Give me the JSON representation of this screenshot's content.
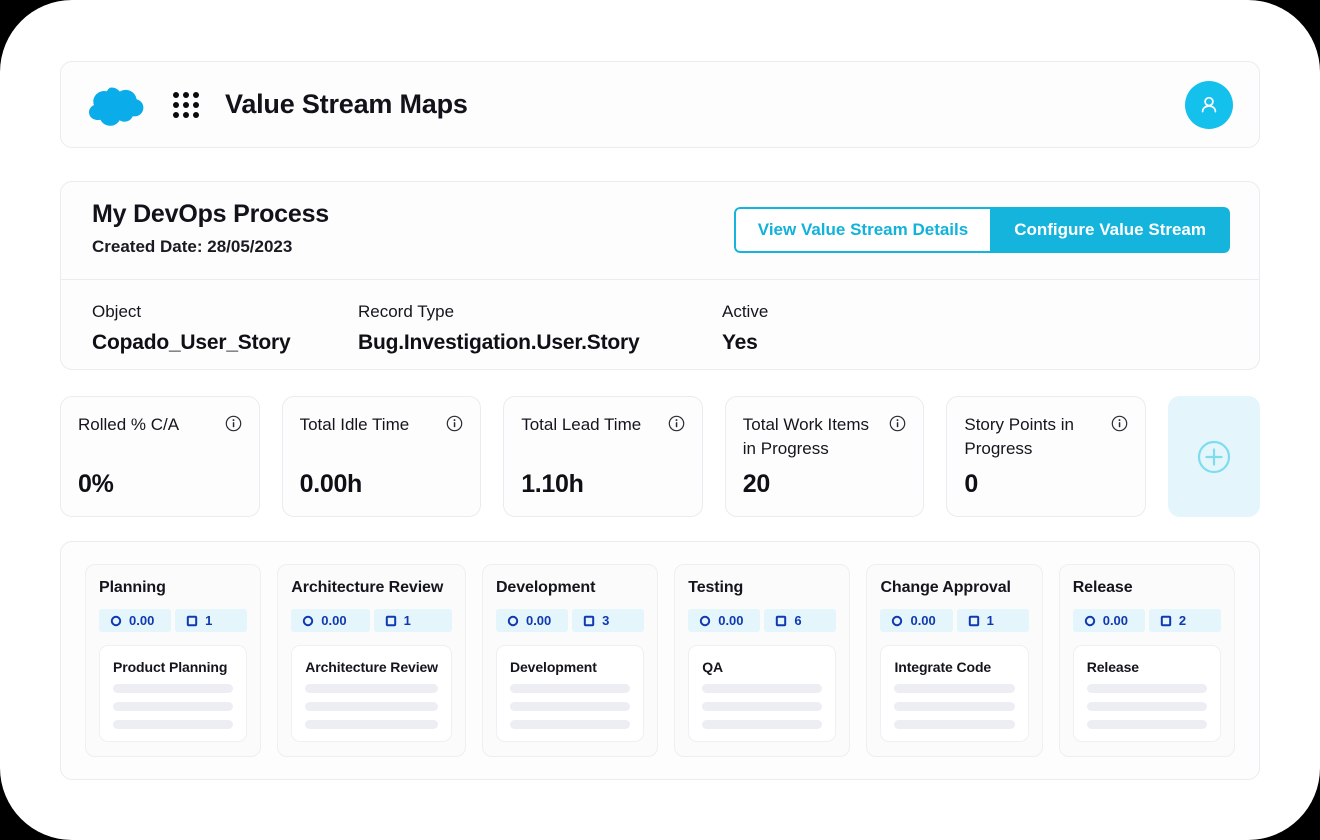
{
  "appbar": {
    "logo_icon": "cloud-icon",
    "app_launcher_icon": "app-grid-icon",
    "title": "Value Stream Maps",
    "avatar_icon": "user-avatar-icon"
  },
  "process": {
    "title": "My DevOps Process",
    "created_date_label": "Created Date: 28/05/2023",
    "buttons": {
      "view_details": "View Value Stream Details",
      "configure": "Configure Value Stream"
    },
    "meta": [
      {
        "label": "Object",
        "value": "Copado_User_Story"
      },
      {
        "label": "Record Type",
        "value": "Bug.Investigation.User.Story"
      },
      {
        "label": "Active",
        "value": "Yes"
      }
    ]
  },
  "metrics": {
    "info_icon": "info-circle-icon",
    "add_icon": "plus-circle-icon",
    "cards": [
      {
        "label": "Rolled % C/A",
        "value": "0%"
      },
      {
        "label": "Total Idle Time",
        "value": "0.00h"
      },
      {
        "label": "Total Lead Time",
        "value": "1.10h"
      },
      {
        "label": "Total Work Items in Progress",
        "value": "20"
      },
      {
        "label": "Story Points in Progress",
        "value": "0"
      }
    ]
  },
  "stages": [
    {
      "title": "Planning",
      "time_icon": "clock-circle-icon",
      "time_value": "0.00",
      "items_icon": "square-outline-icon",
      "items_value": "1",
      "inner_title": "Product Planning"
    },
    {
      "title": "Architecture Review",
      "time_icon": "clock-circle-icon",
      "time_value": "0.00",
      "items_icon": "square-outline-icon",
      "items_value": "1",
      "inner_title": "Architecture Review"
    },
    {
      "title": "Development",
      "time_icon": "clock-circle-icon",
      "time_value": "0.00",
      "items_icon": "square-outline-icon",
      "items_value": "3",
      "inner_title": "Development"
    },
    {
      "title": "Testing",
      "time_icon": "clock-circle-icon",
      "time_value": "0.00",
      "items_icon": "square-outline-icon",
      "items_value": "6",
      "inner_title": "QA"
    },
    {
      "title": "Change Approval",
      "time_icon": "clock-circle-icon",
      "time_value": "0.00",
      "items_icon": "square-outline-icon",
      "items_value": "1",
      "inner_title": "Integrate Code"
    },
    {
      "title": "Release",
      "time_icon": "clock-circle-icon",
      "time_value": "0.00",
      "items_icon": "square-outline-icon",
      "items_value": "2",
      "inner_title": "Release"
    }
  ],
  "colors": {
    "accent": "#14b4dc",
    "accent_soft": "#e4f6fb",
    "badge_text": "#1039b0",
    "text": "#15161d",
    "skeleton": "#eceef3"
  }
}
